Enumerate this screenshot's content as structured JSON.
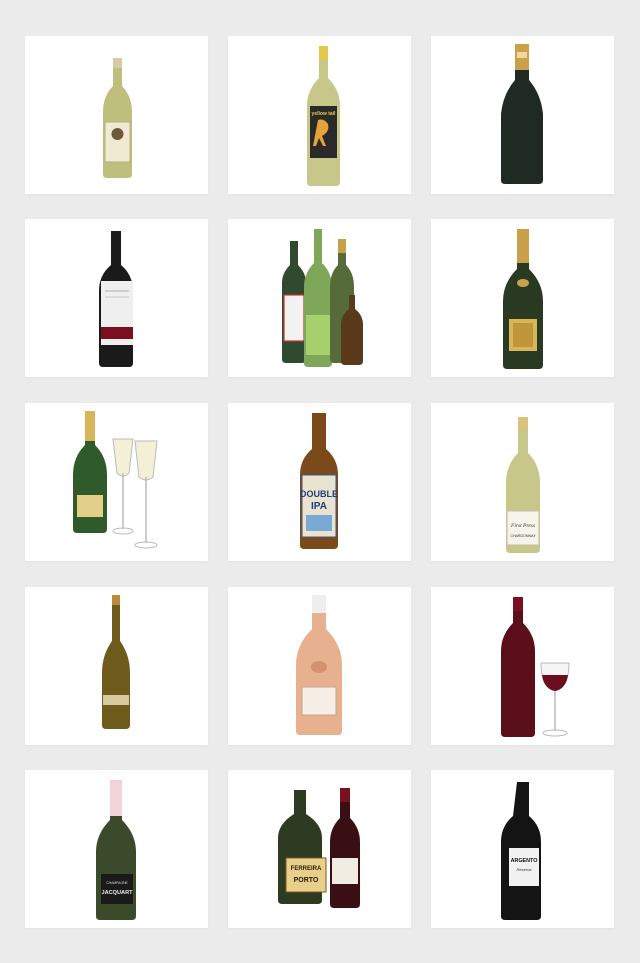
{
  "page": {
    "background": "#ebebeb",
    "card_background": "#ffffff"
  },
  "tiles": [
    {
      "name": "white-wine-bottle-label"
    },
    {
      "name": "yellow-tail-chardonnay"
    },
    {
      "name": "dark-sparkling-bottle"
    },
    {
      "name": "red-wine-white-label"
    },
    {
      "name": "assorted-bottles-group"
    },
    {
      "name": "champagne-gold-foil"
    },
    {
      "name": "champagne-with-flutes"
    },
    {
      "name": "double-ipa-beer"
    },
    {
      "name": "first-press-chardonnay"
    },
    {
      "name": "tall-riesling-bottle"
    },
    {
      "name": "rose-wine-bottle"
    },
    {
      "name": "red-wine-with-glass"
    },
    {
      "name": "jacquart-champagne"
    },
    {
      "name": "ferreira-porto-and-red"
    },
    {
      "name": "argento-reserva"
    }
  ],
  "labels": {
    "yellow_tail": "yellow tail",
    "double_ipa_line1": "DOUBLE",
    "double_ipa_line2": "IPA",
    "first_press": "First Press",
    "first_press_sub": "CHARDONNAY",
    "jacquart_small": "CHAMPAGNE",
    "jacquart": "JACQUART",
    "ferreira": "FERREIRA",
    "porto": "PORTO",
    "argento": "ARGENTO",
    "argento_sub": "Reserva"
  },
  "colors": {
    "white_wine_glass": "#c9c98a",
    "dark_green_glass": "#1f2a22",
    "red_wine": "#6b0f1f",
    "amber_beer": "#7a4a1a",
    "rose": "#e7b08e",
    "gold_foil": "#c9a14a"
  }
}
